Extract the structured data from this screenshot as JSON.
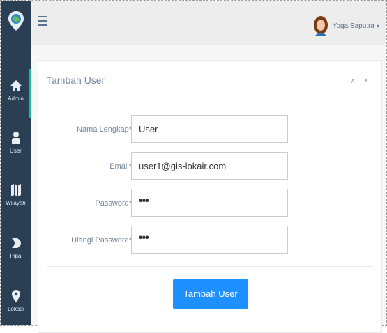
{
  "sidebar": {
    "items": [
      {
        "label": "Admin",
        "icon": "home-icon",
        "active": true
      },
      {
        "label": "User",
        "icon": "user-icon",
        "active": false
      },
      {
        "label": "Wilayah",
        "icon": "map-icon",
        "active": false
      },
      {
        "label": "Pipa",
        "icon": "pipe-icon",
        "active": false
      },
      {
        "label": "Lokasi",
        "icon": "location-pin-icon",
        "active": false
      }
    ]
  },
  "topbar": {
    "user_name": "Yoga Saputra",
    "caret": "▾"
  },
  "panel": {
    "title": "Tambah User",
    "tools": "∧ ✕"
  },
  "form": {
    "fields": [
      {
        "label": "Nama Lengkap*",
        "value": "User",
        "type": "text"
      },
      {
        "label": "Email*",
        "value": "user1@gis-lokair.com",
        "type": "text"
      },
      {
        "label": "Password*",
        "value": "•••",
        "type": "password"
      },
      {
        "label": "Ulangi Password*",
        "value": "•••",
        "type": "password"
      }
    ],
    "submit_label": "Tambah User"
  },
  "colors": {
    "sidebar_bg": "#2a3f54",
    "accent": "#1abb9c",
    "primary_button": "#1e90ff"
  }
}
